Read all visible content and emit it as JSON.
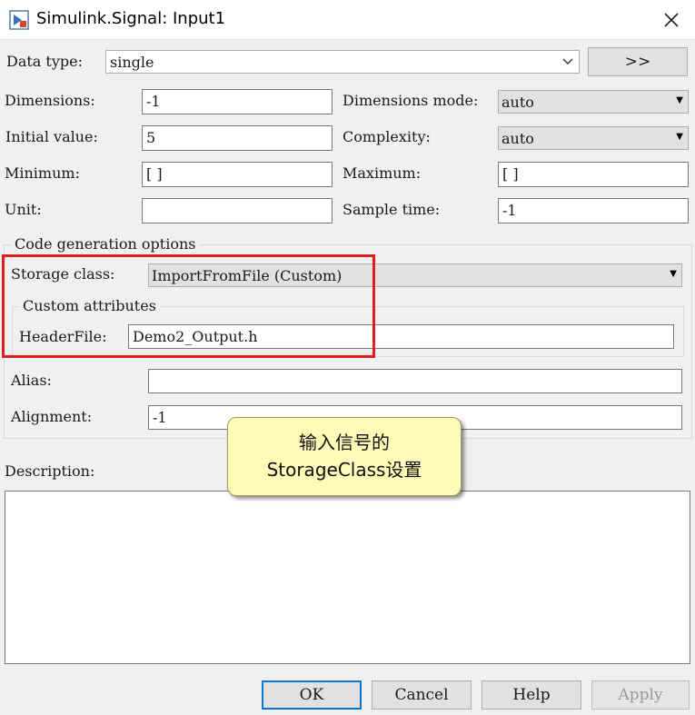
{
  "window": {
    "title": "Simulink.Signal: Input1",
    "close_icon": "close-icon"
  },
  "colors": {
    "highlight_border": "#e21d1d",
    "default_button_border": "#0078d7",
    "callout_fill": "#fffbb8"
  },
  "fields": {
    "data_type": {
      "label": "Data type:",
      "value": "single",
      "expand_button": ">>"
    },
    "dimensions": {
      "label": "Dimensions:",
      "value": "-1"
    },
    "dimensions_mode": {
      "label": "Dimensions mode:",
      "value": "auto"
    },
    "initial_value": {
      "label": "Initial value:",
      "value": "5"
    },
    "complexity": {
      "label": "Complexity:",
      "value": "auto"
    },
    "minimum": {
      "label": "Minimum:",
      "value": "[ ]"
    },
    "maximum": {
      "label": "Maximum:",
      "value": "[ ]"
    },
    "unit": {
      "label": "Unit:",
      "value": ""
    },
    "sample_time": {
      "label": "Sample time:",
      "value": "-1"
    }
  },
  "code_generation": {
    "group_title": "Code generation options",
    "storage_class": {
      "label": "Storage class:",
      "value": "ImportFromFile (Custom)"
    },
    "custom_attributes": {
      "group_title": "Custom attributes",
      "header_file": {
        "label": "HeaderFile:",
        "value": "Demo2_Output.h"
      }
    },
    "alias": {
      "label": "Alias:",
      "value": ""
    },
    "alignment": {
      "label": "Alignment:",
      "value": "-1"
    }
  },
  "description": {
    "label": "Description:",
    "value": ""
  },
  "callout": {
    "line1": "输入信号的",
    "line2": "StorageClass设置"
  },
  "buttons": {
    "ok": "OK",
    "cancel": "Cancel",
    "help": "Help",
    "apply": "Apply"
  }
}
